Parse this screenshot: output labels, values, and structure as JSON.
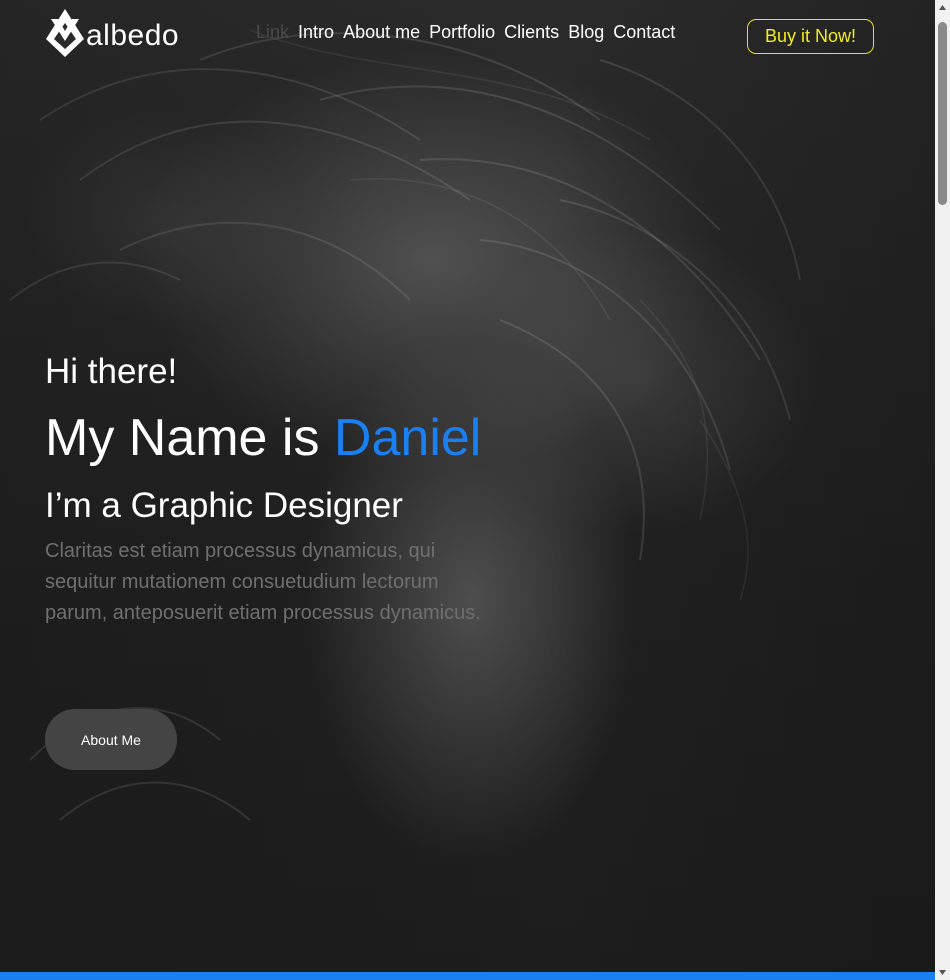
{
  "brand": {
    "name": "albedo",
    "logo_icon": "albedo-logo-icon"
  },
  "nav": {
    "items": [
      {
        "label": "Link",
        "dimmed": true
      },
      {
        "label": "Intro"
      },
      {
        "label": "About me"
      },
      {
        "label": "Portfolio"
      },
      {
        "label": "Clients"
      },
      {
        "label": "Blog"
      },
      {
        "label": "Contact"
      }
    ]
  },
  "cta": {
    "buy_label": "Buy it Now!"
  },
  "hero": {
    "greeting": "Hi there!",
    "name_prefix": "My Name is ",
    "name": "Daniel",
    "role": "I’m a Graphic Designer",
    "description": "Claritas est etiam processus dynamicus, qui sequitur mutationem consuetudium lectorum parum, anteposuerit etiam processus dynamicus.",
    "button_label": "About Me"
  },
  "colors": {
    "accent": "#1a7ff0",
    "cta": "#f2ee1d",
    "background": "#1e1e1e",
    "muted_text": "#6f6f6f"
  }
}
